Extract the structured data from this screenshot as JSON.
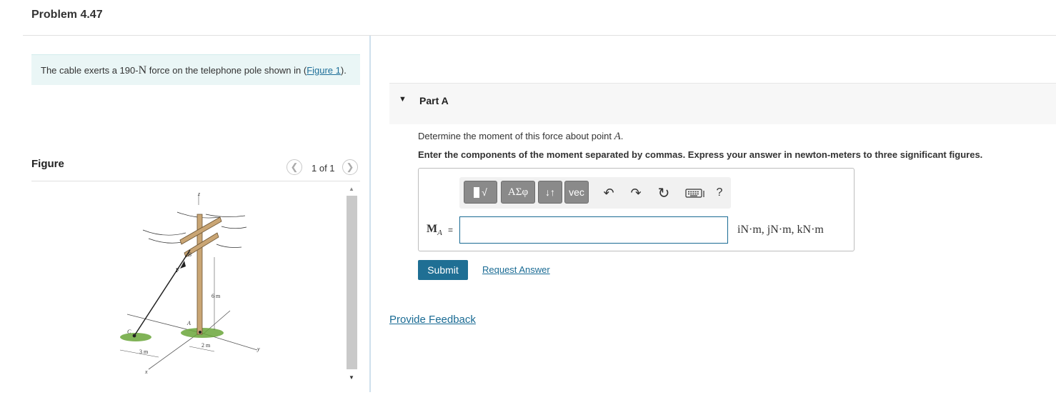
{
  "problem": {
    "title": "Problem 4.47"
  },
  "intro": {
    "text_before": "The cable exerts a 190-",
    "force_unit": "N",
    "text_after": " force on the telephone pole shown in (",
    "figure_link": "Figure 1",
    "text_end": ")."
  },
  "figure": {
    "label": "Figure",
    "counter": "1 of 1",
    "prev_icon": "chevron-left-icon",
    "next_icon": "chevron-right-icon",
    "labels": {
      "z": "z",
      "b": "B",
      "f": "F",
      "a": "A",
      "c": "C",
      "height": "6 m",
      "span_a": "2 m",
      "span_c": "3 m",
      "y": "y",
      "x": "x"
    }
  },
  "part": {
    "caret_icon": "caret-down-icon",
    "title": "Part A",
    "question_before": "Determine the moment of this force about point ",
    "question_symbol": "A",
    "question_after": ".",
    "instructions": "Enter the components of the moment separated by commas. Express your answer in newton-meters to three significant figures."
  },
  "toolbar": {
    "templates_label": "√",
    "greek_label": "ΑΣφ",
    "arrows_label": "↓↑",
    "vec_label": "vec",
    "undo_icon": "undo-icon",
    "redo_icon": "redo-icon",
    "reset_icon": "reset-icon",
    "keyboard_icon": "keyboard-icon",
    "help_label": "?"
  },
  "answer": {
    "label_main": "M",
    "label_sub": "A",
    "equals": "=",
    "value": "",
    "units": "iN·m, jN·m, kN·m"
  },
  "actions": {
    "submit_label": "Submit",
    "request_answer_label": "Request Answer",
    "feedback_label": "Provide Feedback"
  },
  "colors": {
    "accent": "#1f6f94",
    "link": "#1a6b94",
    "intro_bg": "#eaf6f6",
    "toolbar_button": "#8a8a8a",
    "pole": "#c9a574",
    "grass": "#6aa63a"
  }
}
